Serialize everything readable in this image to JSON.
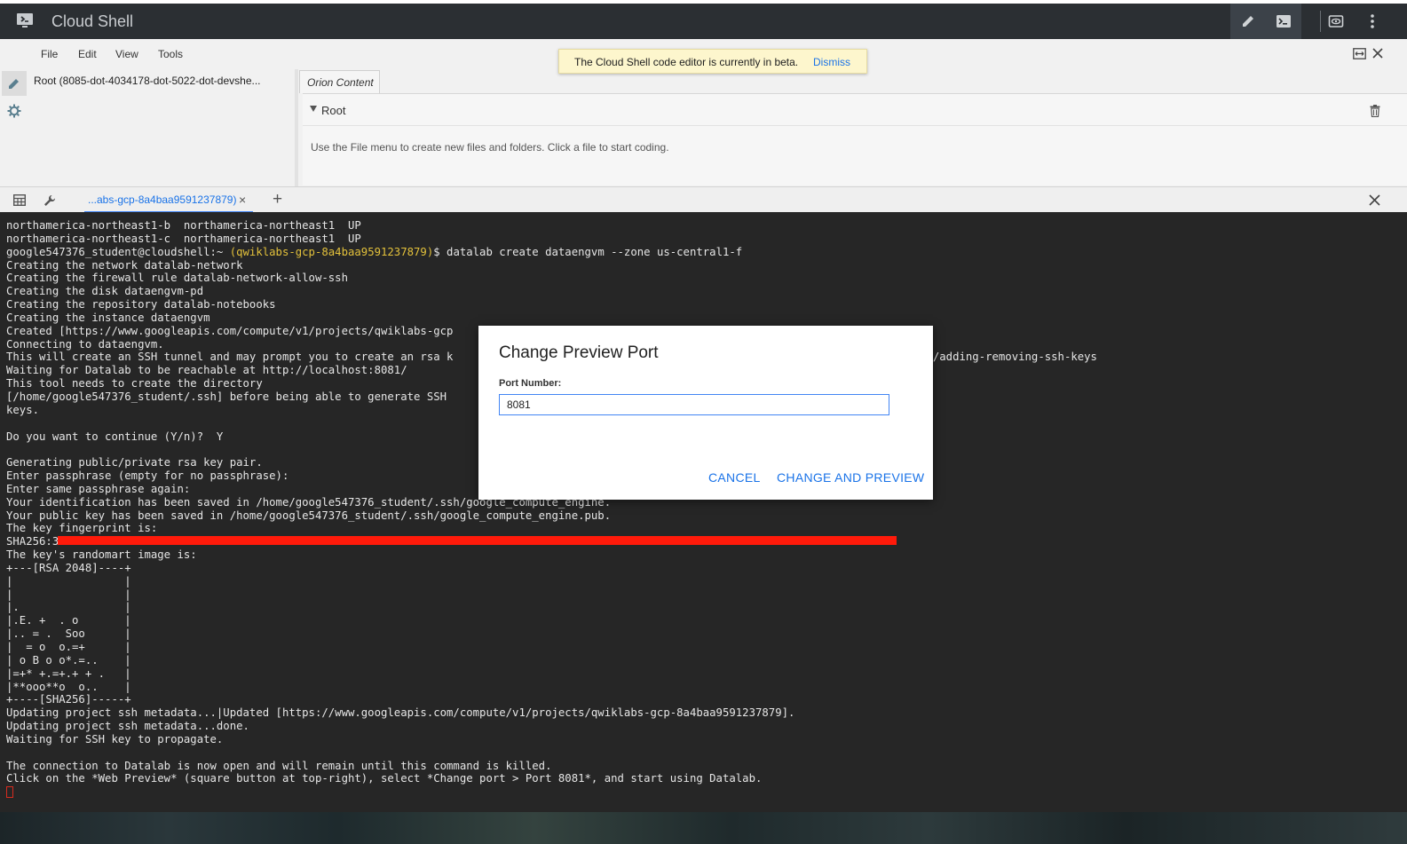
{
  "header": {
    "title": "Cloud Shell",
    "icons": [
      "cloud-shell-logo-icon",
      "edit-pencil-icon",
      "terminal-icon",
      "web-preview-icon",
      "more-vert-icon"
    ]
  },
  "editor": {
    "menu": [
      "File",
      "Edit",
      "View",
      "Tools"
    ],
    "banner": {
      "text": "The Cloud Shell code editor is currently in beta.",
      "dismiss": "Dismiss"
    },
    "tree_root": "Root (8085-dot-4034178-dot-5022-dot-devshe...",
    "tab": "Orion Content",
    "root_label": "Root",
    "hint": "Use the File menu to create new files and folders. Click a file to start coding."
  },
  "terminal_tabs": {
    "active_tab": "...abs-gcp-8a4baa9591237879)",
    "close": "×",
    "add": "+"
  },
  "terminal": {
    "prompt_user": "google547376_student@cloudshell:~ ",
    "prompt_project": "(qwiklabs-gcp-8a4baa9591237879)",
    "prompt_command": "$ datalab create dataengvm --zone us-central1-f",
    "lines_before": [
      "northamerica-northeast1-b  northamerica-northeast1  UP",
      "northamerica-northeast1-c  northamerica-northeast1  UP"
    ],
    "lines_after": [
      "Creating the network datalab-network",
      "Creating the firewall rule datalab-network-allow-ssh",
      "Creating the disk dataengvm-pd",
      "Creating the repository datalab-notebooks",
      "Creating the instance dataengvm",
      "Created [https://www.googleapis.com/compute/v1/projects/qwiklabs-gcp",
      "Connecting to dataengvm.",
      "This will create an SSH tunnel and may prompt you to create an rsa k                                                         e/docs/instances/adding-removing-ssh-keys",
      "Waiting for Datalab to be reachable at http://localhost:8081/",
      "This tool needs to create the directory",
      "[/home/google547376_student/.ssh] before being able to generate SSH",
      "keys.",
      "",
      "Do you want to continue (Y/n)?  Y",
      "",
      "Generating public/private rsa key pair.",
      "Enter passphrase (empty for no passphrase):",
      "Enter same passphrase again:",
      "Your identification has been saved in /home/google547376_student/.ssh/google_compute_engine.",
      "Your public key has been saved in /home/google547376_student/.ssh/google_compute_engine.pub.",
      "The key fingerprint is:",
      "SHA256:3",
      "The key's randomart image is:",
      "+---[RSA 2048]----+",
      "|                 |",
      "|                 |",
      "|.                |",
      "|.E. +  . o       |",
      "|.. = .  Soo      |",
      "|  = o  o.=+      |",
      "| o B o o*.=..    |",
      "|=+* +.=+.+ + .   |",
      "|**ooo**o  o..    |",
      "+----[SHA256]-----+",
      "Updating project ssh metadata...|Updated [https://www.googleapis.com/compute/v1/projects/qwiklabs-gcp-8a4baa9591237879].",
      "Updating project ssh metadata...done.",
      "Waiting for SSH key to propagate.",
      "",
      "The connection to Datalab is now open and will remain until this command is killed.",
      "Click on the *Web Preview* (square button at top-right), select *Change port > Port 8081*, and start using Datalab."
    ]
  },
  "modal": {
    "title": "Change Preview Port",
    "port_label": "Port Number:",
    "port_value": "8081",
    "cancel": "CANCEL",
    "confirm": "CHANGE AND PREVIEW"
  }
}
